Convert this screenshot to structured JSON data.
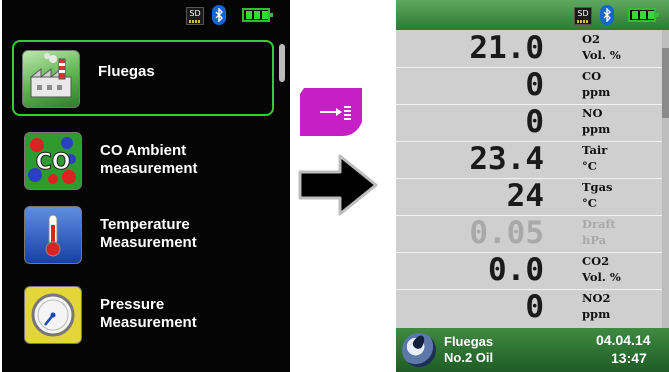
{
  "left_screen": {
    "status": {
      "sd_label": "SD",
      "sd_icon": "sd-card-icon",
      "bluetooth_icon": "bluetooth-icon",
      "battery_icon": "battery-icon"
    },
    "menu": [
      {
        "label_line1": "Fluegas",
        "label_line2": "",
        "icon": "factory-chimney-icon",
        "selected": true
      },
      {
        "label_line1": "CO Ambient",
        "label_line2": "measurement",
        "icon": "co-molecule-icon",
        "selected": false
      },
      {
        "label_line1": "Temperature",
        "label_line2": "Measurement",
        "icon": "thermometer-icon",
        "selected": false
      },
      {
        "label_line1": "Pressure",
        "label_line2": "Measurement",
        "icon": "pressure-gauge-icon",
        "selected": false
      }
    ]
  },
  "key_button": {
    "icon": "arrow-to-list-icon",
    "color": "#c51fc5"
  },
  "arrow": {
    "icon": "right-arrow-icon"
  },
  "right_screen": {
    "status": {
      "sd_label": "SD",
      "sd_icon": "sd-card-icon",
      "bluetooth_icon": "bluetooth-icon",
      "battery_icon": "battery-icon"
    },
    "readings": [
      {
        "value": "21.0",
        "name": "O2",
        "unit": "Vol. %",
        "dim": false
      },
      {
        "value": "0",
        "name": "CO",
        "unit": "ppm",
        "dim": false
      },
      {
        "value": "0",
        "name": "NO",
        "unit": "ppm",
        "dim": false
      },
      {
        "value": "23.4",
        "name": "Tair",
        "unit": "°C",
        "dim": false
      },
      {
        "value": "24",
        "name": "Tgas",
        "unit": "°C",
        "dim": false
      },
      {
        "value": "0.05",
        "name": "Draft",
        "unit": "hPa",
        "dim": true
      },
      {
        "value": "0.0",
        "name": "CO2",
        "unit": "Vol. %",
        "dim": false
      },
      {
        "value": "0",
        "name": "NO2",
        "unit": "ppm",
        "dim": false
      }
    ],
    "footer": {
      "title": "Fluegas",
      "fuel": "No.2 Oil",
      "date": "04.04.14",
      "time": "13:47",
      "icon": "fuel-drop-icon"
    }
  },
  "colors": {
    "selection": "#2fd12f",
    "status_green": "#3f8a41",
    "reading_bg": "#cfcfcf",
    "key_magenta": "#c51fc5"
  }
}
